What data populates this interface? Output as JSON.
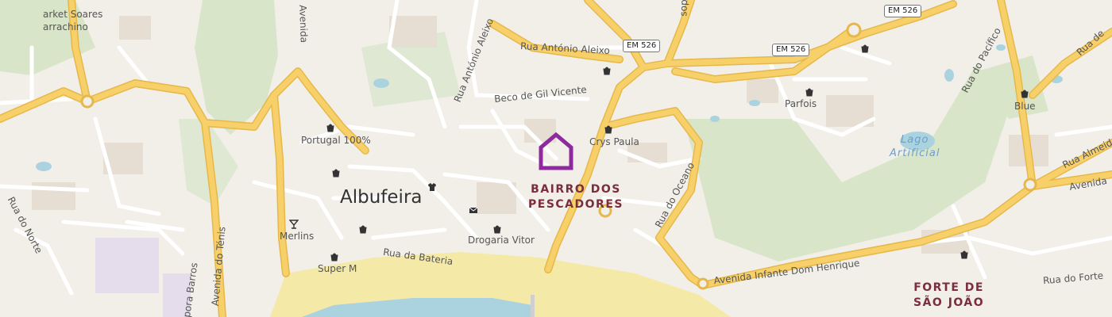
{
  "map": {
    "colors": {
      "land": "#f2efe9",
      "road_major": "#f7d06a",
      "road_major_casing": "#e6b84a",
      "road_minor": "#ffffff",
      "park": "#d8e5c8",
      "sand": "#f5e9a8",
      "water": "#aad3df",
      "building": "#e6ddd3",
      "marker": "#8e2a9e"
    },
    "town": "Albufeira",
    "districts": [
      {
        "line1": "BAIRRO DOS",
        "line2": "PESCADORES"
      },
      {
        "line1": "FORTE DE",
        "line2": "SÃO JOÃO"
      }
    ],
    "water_label": {
      "line1": "Lago",
      "line2": "Artificial"
    },
    "road_shields": [
      "EM 526",
      "EM 526",
      "EM 526"
    ],
    "streets": {
      "rua_antonio_aleixo_h": "Rua António Aleixo",
      "rua_antonio_aleixo_v": "Rua António Aleixo",
      "beco_gil_vicente": "Beco de Gil Vicente",
      "rua_bateria": "Rua da Bateria",
      "avenida_infante": "Avenida Infante Dom Henrique",
      "rua_do_oceano": "Rua do Oceano",
      "rua_do_pacifico": "Rua do Pacífico",
      "rua_do_forte": "Rua do Forte",
      "rua_do_norte": "Rua do Norte",
      "avenida_do_tenis": "Avenida do Ténis",
      "rua_almeida": "Rua Almeid",
      "avenida_right": "Avenida",
      "rua_de_right": "Rua de",
      "avenida_top": "Avenida",
      "sop_top": "sop",
      "prora_barros": "pora Barros"
    },
    "pois": {
      "market_soares": "arket Soares",
      "market_soares_2": "arrachino",
      "portugal_100": "Portugal 100%",
      "merlins": "Merlins",
      "super_m": "Super M",
      "drogaria_vitor": "Drogaria Vitor",
      "crys_paula": "Crys Paula",
      "parfois": "Parfois",
      "blue": "Blue"
    },
    "icons": [
      "shop-icon",
      "bar-icon",
      "clothes-icon",
      "post-office-icon",
      "home-marker-icon"
    ]
  }
}
